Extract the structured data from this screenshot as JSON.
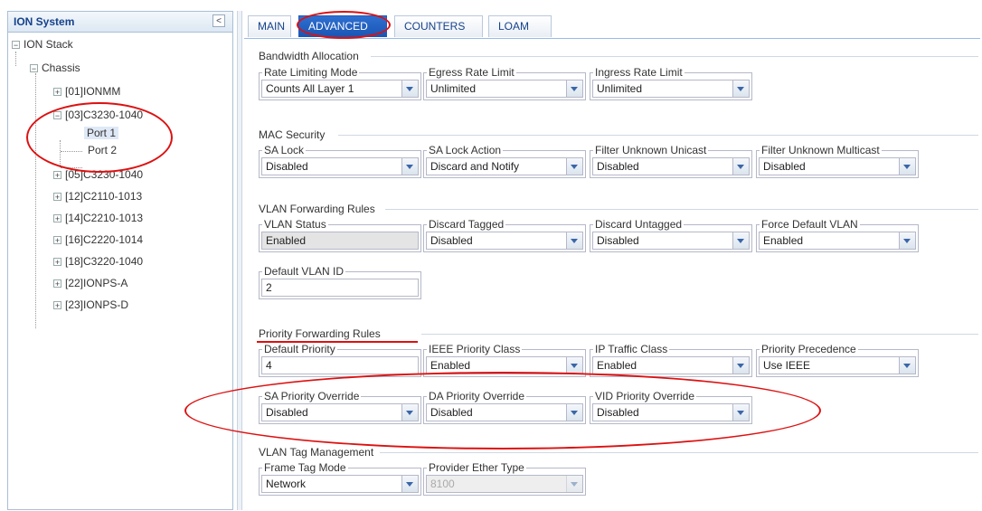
{
  "tree": {
    "title": "ION System",
    "collapse_glyph": "<",
    "nodes": {
      "ion_stack": "ION Stack",
      "chassis": "Chassis",
      "n01": "[01]IONMM",
      "n03": "[03]C3230-1040",
      "port1": "Port 1",
      "port2": "Port 2",
      "n05": "[05]C3230-1040",
      "n12": "[12]C2110-1013",
      "n14": "[14]C2210-1013",
      "n16": "[16]C2220-1014",
      "n18": "[18]C3220-1040",
      "n22": "[22]IONPS-A",
      "n23": "[23]IONPS-D"
    }
  },
  "tabs": {
    "main": "MAIN",
    "advanced": "ADVANCED",
    "counters": "COUNTERS",
    "loam": "LOAM"
  },
  "sections": {
    "bandwidth": {
      "title": "Bandwidth Allocation",
      "rate_limiting_mode": {
        "label": "Rate Limiting Mode",
        "value": "Counts All Layer 1"
      },
      "egress_rate_limit": {
        "label": "Egress Rate Limit",
        "value": "Unlimited"
      },
      "ingress_rate_limit": {
        "label": "Ingress Rate Limit",
        "value": "Unlimited"
      }
    },
    "mac_security": {
      "title": "MAC Security",
      "sa_lock": {
        "label": "SA Lock",
        "value": "Disabled"
      },
      "sa_lock_action": {
        "label": "SA Lock Action",
        "value": "Discard and Notify"
      },
      "filter_unknown_unicast": {
        "label": "Filter Unknown Unicast",
        "value": "Disabled"
      },
      "filter_unknown_multicast": {
        "label": "Filter Unknown Multicast",
        "value": "Disabled"
      }
    },
    "vlan_forwarding": {
      "title": "VLAN Forwarding Rules",
      "vlan_status": {
        "label": "VLAN Status",
        "value": "Enabled"
      },
      "discard_tagged": {
        "label": "Discard Tagged",
        "value": "Disabled"
      },
      "discard_untagged": {
        "label": "Discard Untagged",
        "value": "Disabled"
      },
      "force_default_vlan": {
        "label": "Force Default VLAN",
        "value": "Enabled"
      },
      "default_vlan_id": {
        "label": "Default VLAN ID",
        "value": "2"
      }
    },
    "priority_forwarding": {
      "title": "Priority Forwarding Rules",
      "default_priority": {
        "label": "Default Priority",
        "value": "4"
      },
      "ieee_priority_class": {
        "label": "IEEE Priority Class",
        "value": "Enabled"
      },
      "ip_traffic_class": {
        "label": "IP Traffic Class",
        "value": "Enabled"
      },
      "priority_precedence": {
        "label": "Priority Precedence",
        "value": "Use IEEE"
      },
      "sa_priority_override": {
        "label": "SA Priority Override",
        "value": "Disabled"
      },
      "da_priority_override": {
        "label": "DA Priority Override",
        "value": "Disabled"
      },
      "vid_priority_override": {
        "label": "VID Priority Override",
        "value": "Disabled"
      }
    },
    "vlan_tag": {
      "title": "VLAN Tag Management",
      "frame_tag_mode": {
        "label": "Frame Tag Mode",
        "value": "Network"
      },
      "provider_ether_type": {
        "label": "Provider Ether Type",
        "value": "8100"
      }
    }
  },
  "colors": {
    "annotation": "#dd1111",
    "active_tab": "#1a55b4",
    "tree_title": "#15428b"
  }
}
